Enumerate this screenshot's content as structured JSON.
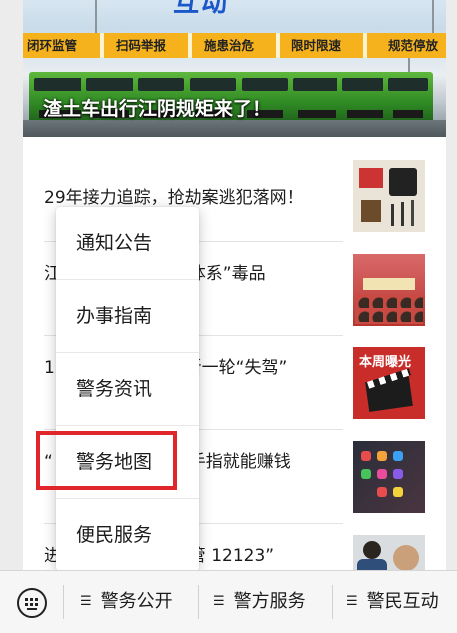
{
  "banner": {
    "logo_text": "互动",
    "tags": [
      "闭环监管",
      "扫码举报",
      "施患治危",
      "限时限速",
      "规范停放"
    ],
    "caption": "渣土车出行江阴规矩来了！"
  },
  "news": [
    {
      "title": "29年接力追踪，抢劫案逃犯落网！",
      "thumb_icon": "evidence-photo"
    },
    {
      "title": "江　　　　　　“全体系”毒品",
      "thumb_icon": "group-photo"
    },
    {
      "title": "18　　　　　　入新一轮“失驾”",
      "thumb_icon": "weekly-exposure-photo",
      "thumb_text": "本周曝光"
    },
    {
      "title": "“　　　　　　动动手指就能赚钱",
      "thumb_icon": "phone-apps-photo"
    },
    {
      "title": "进　　　　　　“交管 12123”",
      "thumb_icon": "people-photo"
    }
  ],
  "popup": {
    "items": [
      "通知公告",
      "办事指南",
      "警务资讯",
      "警务地图",
      "便民服务"
    ],
    "highlighted_index": 3,
    "highlight_color": "#e0262b"
  },
  "bottom_bar": {
    "keyboard_icon": "keyboard-icon",
    "menus": [
      "警务公开",
      "警方服务",
      "警民互动"
    ]
  }
}
